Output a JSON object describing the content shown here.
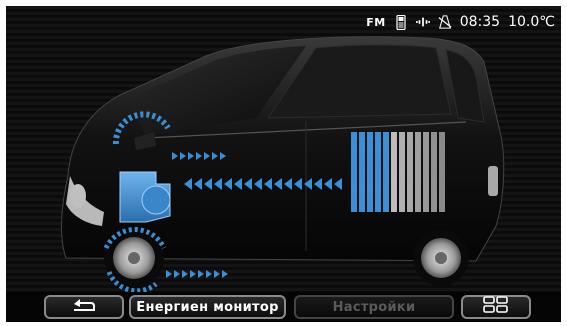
{
  "status_bar": {
    "radio_source": "FM",
    "phone_icon": "phone-icon",
    "signal_icon": "signal-icon",
    "navigation_icon": "gps-off-icon",
    "time": "08:35",
    "temperature": "10.0℃"
  },
  "scene": {
    "description_icon": "car-energy-flow",
    "accent_color": "#3a8fd6",
    "battery_color": "#2f7fc7"
  },
  "bottom_bar": {
    "back_icon": "back-arrow-icon",
    "energy_monitor_label": "Енергиен монитор",
    "settings_label": "Настройки",
    "home_icon": "grid-menu-icon"
  }
}
